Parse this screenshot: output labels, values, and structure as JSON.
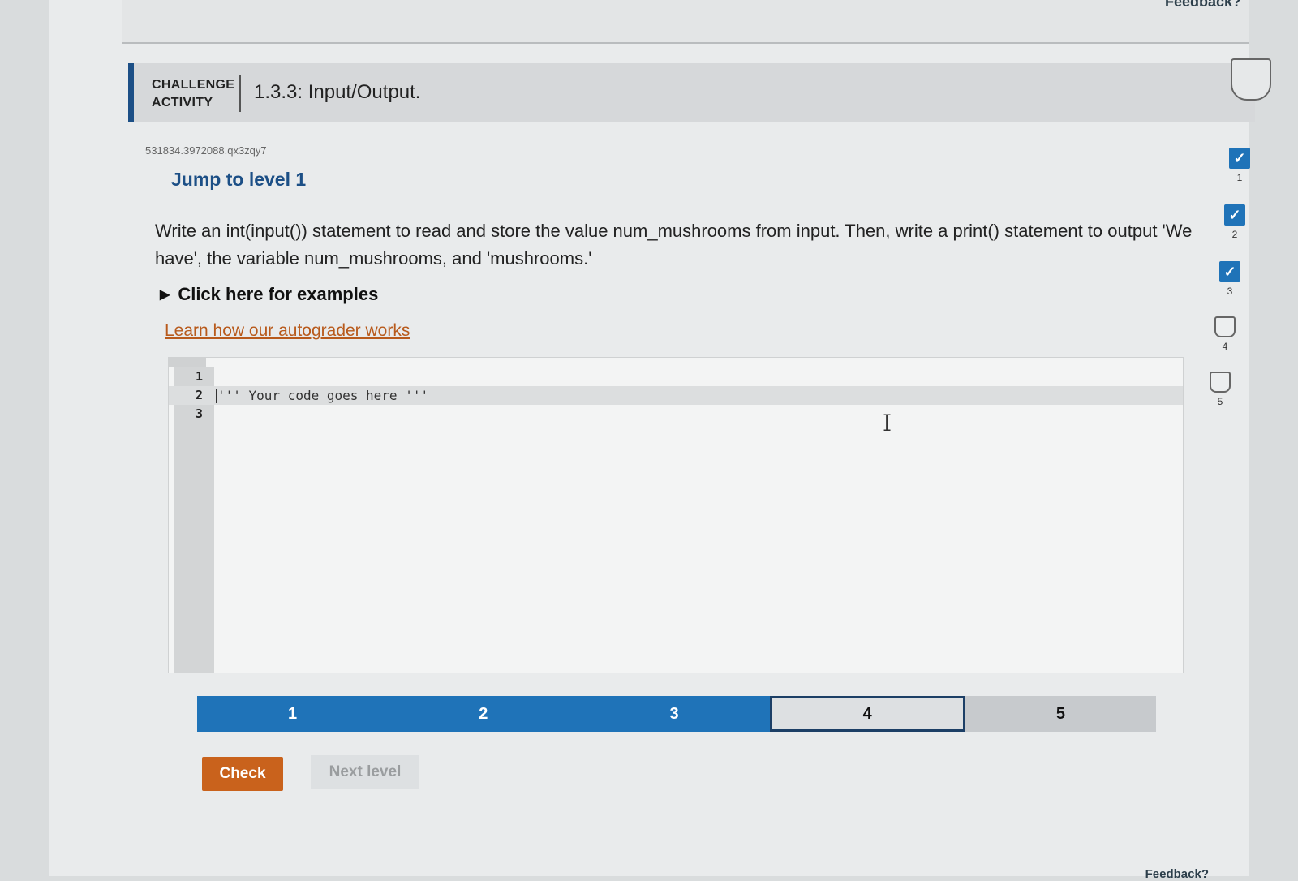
{
  "feedback_label": "Feedback?",
  "activity": {
    "type_line1": "CHALLENGE",
    "type_line2": "ACTIVITY",
    "title": "1.3.3: Input/Output.",
    "id": "531834.3972088.qx3zqy7"
  },
  "jump_to_level": "Jump to level 1",
  "instructions": "Write an int(input()) statement to read and store the value num_mushrooms from input. Then, write a print() statement to output 'We have', the variable num_mushrooms, and 'mushrooms.'",
  "examples_toggle": "Click here for examples",
  "autograder_link": "Learn how our autograder works",
  "editor": {
    "lines": [
      {
        "num": "1",
        "code": ""
      },
      {
        "num": "2",
        "code": "''' Your code goes here '''"
      },
      {
        "num": "3",
        "code": ""
      }
    ],
    "active_line": 2
  },
  "levels": [
    {
      "label": "1",
      "state": "done"
    },
    {
      "label": "2",
      "state": "done"
    },
    {
      "label": "3",
      "state": "done"
    },
    {
      "label": "4",
      "state": "current"
    },
    {
      "label": "5",
      "state": "todo"
    }
  ],
  "buttons": {
    "check": "Check",
    "next_level": "Next level"
  },
  "side_progress": [
    {
      "num": "1",
      "state": "done"
    },
    {
      "num": "2",
      "state": "done"
    },
    {
      "num": "3",
      "state": "done"
    },
    {
      "num": "4",
      "state": "todo"
    },
    {
      "num": "5",
      "state": "todo"
    }
  ],
  "icons": {
    "check_mark": "check-icon",
    "triangle": "triangle-right-icon",
    "text_cursor": "ibeam-cursor-icon"
  },
  "colors": {
    "accent_blue": "#1f73b8",
    "header_accent": "#1c4f86",
    "check_button": "#c9621c",
    "link": "#b85a1c"
  }
}
